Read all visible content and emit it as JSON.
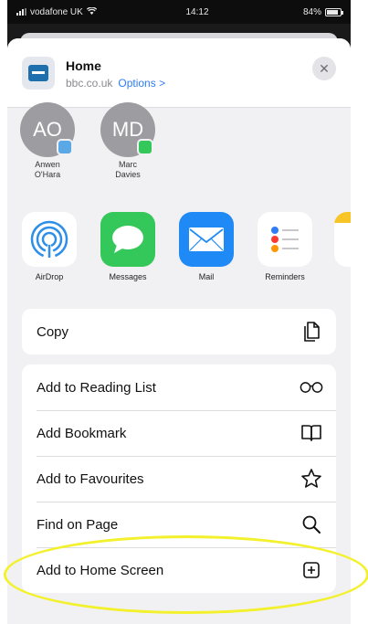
{
  "status_bar": {
    "carrier": "vodafone UK",
    "time": "14:12",
    "battery": "84%",
    "battery_level": 0.84
  },
  "header": {
    "title": "Home",
    "url": "bbc.co.uk",
    "options_label": "Options >",
    "close_glyph": "✕"
  },
  "people": [
    {
      "initials": "AO",
      "name_line1": "Anwen",
      "name_line2": "O'Hara",
      "badge": "airdrop-badge-icon",
      "badge_color": "#5aa9e6"
    },
    {
      "initials": "MD",
      "name_line1": "Marc",
      "name_line2": "Davies",
      "badge": "messages-badge-icon",
      "badge_color": "#34c759"
    }
  ],
  "apps": [
    {
      "label": "AirDrop",
      "icon": "airdrop-icon",
      "color": "#ffffff"
    },
    {
      "label": "Messages",
      "icon": "messages-icon",
      "color": "#34c759"
    },
    {
      "label": "Mail",
      "icon": "mail-icon",
      "color": "#1f8af5"
    },
    {
      "label": "Reminders",
      "icon": "reminders-icon",
      "color": "#ffffff"
    }
  ],
  "actions_group1": [
    {
      "label": "Copy",
      "icon": "copy-icon"
    }
  ],
  "actions_group2": [
    {
      "label": "Add to Reading List",
      "icon": "glasses-icon"
    },
    {
      "label": "Add Bookmark",
      "icon": "book-icon"
    },
    {
      "label": "Add to Favourites",
      "icon": "star-icon"
    },
    {
      "label": "Find on Page",
      "icon": "magnifier-icon"
    },
    {
      "label": "Add to Home Screen",
      "icon": "add-square-icon"
    }
  ],
  "colors": {
    "accent": "#2f7cf6",
    "highlight": "#f3f02c",
    "sheet_background": "#f1f1f4"
  }
}
